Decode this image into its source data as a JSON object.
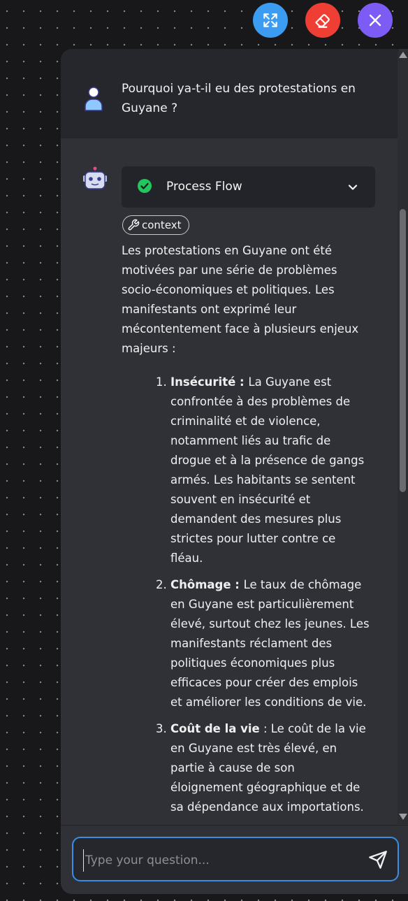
{
  "toolbar": {
    "expand_icon": "expand-arrows-icon",
    "erase_icon": "eraser-icon",
    "close_icon": "close-icon",
    "colors": {
      "expand": "#3b9cf2",
      "erase": "#ef3f35",
      "close": "#7c5cf4"
    }
  },
  "conversation": {
    "user_message": "Pourquoi ya-t-il eu des protestations en Guyane ?",
    "bot": {
      "process_flow_label": "Process Flow",
      "context_badge": "context",
      "intro": "Les protestations en Guyane ont été motivées par une série de problèmes socio-économiques et politiques. Les manifestants ont exprimé leur mécontentement face à plusieurs enjeux majeurs :",
      "items": [
        {
          "title": "Insécurité",
          "sep": " : ",
          "text": "La Guyane est confrontée à des problèmes de criminalité et de violence, notamment liés au trafic de drogue et à la présence de gangs armés. Les habitants se sentent souvent en insécurité et demandent des mesures plus strictes pour lutter contre ce fléau."
        },
        {
          "title": "Chômage",
          "sep": " : ",
          "text": "Le taux de chômage en Guyane est particulièrement élevé, surtout chez les jeunes. Les manifestants réclament des politiques économiques plus efficaces pour créer des emplois et améliorer les conditions de vie."
        },
        {
          "title": "Coût de la vie",
          "sep": " : ",
          "text": "Le coût de la vie en Guyane est très élevé, en partie à cause de son éloignement géographique et de sa dépendance aux importations."
        }
      ]
    }
  },
  "input": {
    "placeholder": "Type your question...",
    "send_icon": "send-icon"
  }
}
